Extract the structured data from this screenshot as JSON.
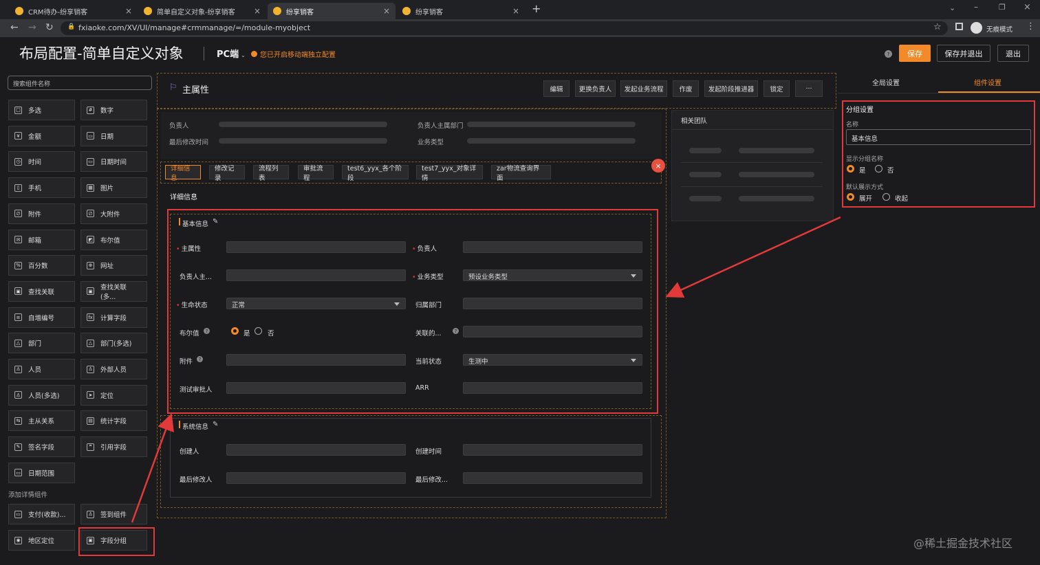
{
  "browser": {
    "tabs": [
      {
        "title": "CRM待办-纷享销客"
      },
      {
        "title": "简单自定义对象-纷享销客"
      },
      {
        "title": "纷享销客"
      },
      {
        "title": "纷享销客"
      }
    ],
    "url": "fxiaoke.com/XV/UI/manage#crmmanage/=/module-myobject",
    "incognito_label": "无痕模式"
  },
  "header": {
    "title": "布局配置-简单自定义对象",
    "platform": "PC端",
    "notice": "您已开启移动端独立配置",
    "save": "保存",
    "save_exit": "保存并退出",
    "exit": "退出"
  },
  "left": {
    "search_placeholder": "搜索组件名称",
    "components": [
      {
        "label": "多选",
        "icon": "□"
      },
      {
        "label": "数字",
        "icon": "#"
      },
      {
        "label": "金额",
        "icon": "¥"
      },
      {
        "label": "日期",
        "icon": "▭"
      },
      {
        "label": "时间",
        "icon": "◷"
      },
      {
        "label": "日期时间",
        "icon": "▭"
      },
      {
        "label": "手机",
        "icon": "▯"
      },
      {
        "label": "图片",
        "icon": "▦"
      },
      {
        "label": "附件",
        "icon": "∅"
      },
      {
        "label": "大附件",
        "icon": "∅"
      },
      {
        "label": "邮箱",
        "icon": "✉"
      },
      {
        "label": "布尔值",
        "icon": "◩"
      },
      {
        "label": "百分数",
        "icon": "%"
      },
      {
        "label": "网址",
        "icon": "⊕"
      },
      {
        "label": "查找关联",
        "icon": "▣"
      },
      {
        "label": "查找关联(多...",
        "icon": "▣"
      },
      {
        "label": "自增编号",
        "icon": "≡"
      },
      {
        "label": "计算字段",
        "icon": "fx"
      },
      {
        "label": "部门",
        "icon": "△"
      },
      {
        "label": "部门(多选)",
        "icon": "△"
      },
      {
        "label": "人员",
        "icon": "♙"
      },
      {
        "label": "外部人员",
        "icon": "♙"
      },
      {
        "label": "人员(多选)",
        "icon": "♙"
      },
      {
        "label": "定位",
        "icon": "➤"
      },
      {
        "label": "主从关系",
        "icon": "⇆"
      },
      {
        "label": "统计字段",
        "icon": "▤"
      },
      {
        "label": "签名字段",
        "icon": "✎"
      },
      {
        "label": "引用字段",
        "icon": "❞"
      },
      {
        "label": "日期范围",
        "icon": "▭"
      }
    ],
    "detail_section": "添加详情组件",
    "detail_components": [
      {
        "label": "支付(收款)...",
        "icon": "▭"
      },
      {
        "label": "签到组件",
        "icon": "♙"
      },
      {
        "label": "地区定位",
        "icon": "◉"
      },
      {
        "label": "字段分组",
        "icon": "▣"
      }
    ]
  },
  "main": {
    "object_title": "主属性",
    "buttons": [
      "编辑",
      "更换负责人",
      "发起业务流程",
      "作废",
      "发起阶段推进器",
      "锁定",
      "···"
    ],
    "summary": {
      "owner": "负责人",
      "owner_dept": "负责人主属部门",
      "last_modified": "最后修改时间",
      "biz_type": "业务类型"
    },
    "related_team": "相关团队",
    "tabs": [
      "详细信息",
      "修改记录",
      "流程列表",
      "审批流程",
      "test6_yyx_各个阶段",
      "test7_yyx_对象详情",
      "zar物流查询界面"
    ],
    "detail_header": "详细信息",
    "basic_group": {
      "title": "基本信息",
      "fields": {
        "main_attr": "主属性",
        "owner": "负责人",
        "owner_dept": "负责人主...",
        "biz_type": "业务类型",
        "biz_type_value": "预设业务类型",
        "life_status": "生命状态",
        "life_status_value": "正常",
        "belong_dept": "归属部门",
        "bool": "布尔值",
        "yes": "是",
        "no": "否",
        "related": "关联的...",
        "attachment": "附件",
        "cur_status": "当前状态",
        "cur_status_value": "生测中",
        "test_approver": "测试审批人",
        "arr": "ARR"
      }
    },
    "system_group": {
      "title": "系统信息",
      "fields": {
        "creator": "创建人",
        "create_time": "创建时间",
        "last_modifier": "最后修改人",
        "last_modified": "最后修改..."
      }
    }
  },
  "right": {
    "tab_global": "全局设置",
    "tab_component": "组件设置",
    "section_title": "分组设置",
    "name_label": "名称",
    "name_value": "基本信息",
    "show_name_label": "显示分组名称",
    "show_yes": "是",
    "show_no": "否",
    "display_label": "默认展示方式",
    "expand": "展开",
    "collapse": "收起"
  },
  "watermark": "@稀土掘金技术社区",
  "colors": {
    "accent": "#f28a2a",
    "highlight": "#e23a3a"
  }
}
